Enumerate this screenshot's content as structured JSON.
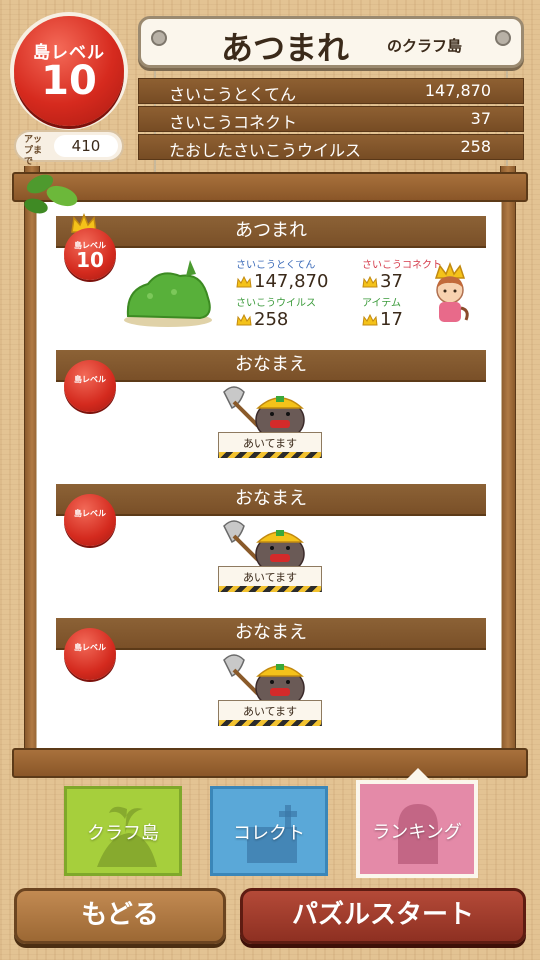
{
  "header": {
    "level_label": "島レベル",
    "level_value": "10",
    "up_label": "アップまで",
    "up_value": "410",
    "island_name": "あつまれ",
    "island_suffix": "のクラフ島",
    "stats": [
      {
        "label": "さいこうとくてん",
        "value": "147,870"
      },
      {
        "label": "さいこうコネクト",
        "value": "37"
      },
      {
        "label": "たおしたさいこうウイルス",
        "value": "258"
      }
    ]
  },
  "ranking_panels": [
    {
      "name": "あつまれ",
      "level_label": "島レベル",
      "level_value": "10",
      "best_score_label": "さいこうとくてん",
      "best_score": "147,870",
      "best_connect_label": "さいこうコネクト",
      "best_connect": "37",
      "best_virus_label": "さいこうウイルス",
      "best_virus": "258",
      "item_label": "アイテム",
      "item": "17"
    },
    {
      "name": "おなまえ",
      "level_label": "島レベル",
      "empty_label": "あいてます"
    },
    {
      "name": "おなまえ",
      "level_label": "島レベル",
      "empty_label": "あいてます"
    },
    {
      "name": "おなまえ",
      "level_label": "島レベル",
      "empty_label": "あいてます"
    }
  ],
  "tabs": [
    {
      "label": "クラフ島",
      "color": "#a6cf3c"
    },
    {
      "label": "コレクト",
      "color": "#5aa8d8"
    },
    {
      "label": "ランキング",
      "color": "#e48aa8",
      "selected": true
    }
  ],
  "buttons": {
    "back": "もどる",
    "start": "パズルスタート"
  },
  "colors": {
    "accent_red": "#d62a1e",
    "wood": "#7a5028",
    "stat_label_blue": "#3a6ab8",
    "stat_label_red": "#d43a4a",
    "stat_label_green": "#3a9a3a",
    "stat_label_yellow": "#d89a1a"
  }
}
